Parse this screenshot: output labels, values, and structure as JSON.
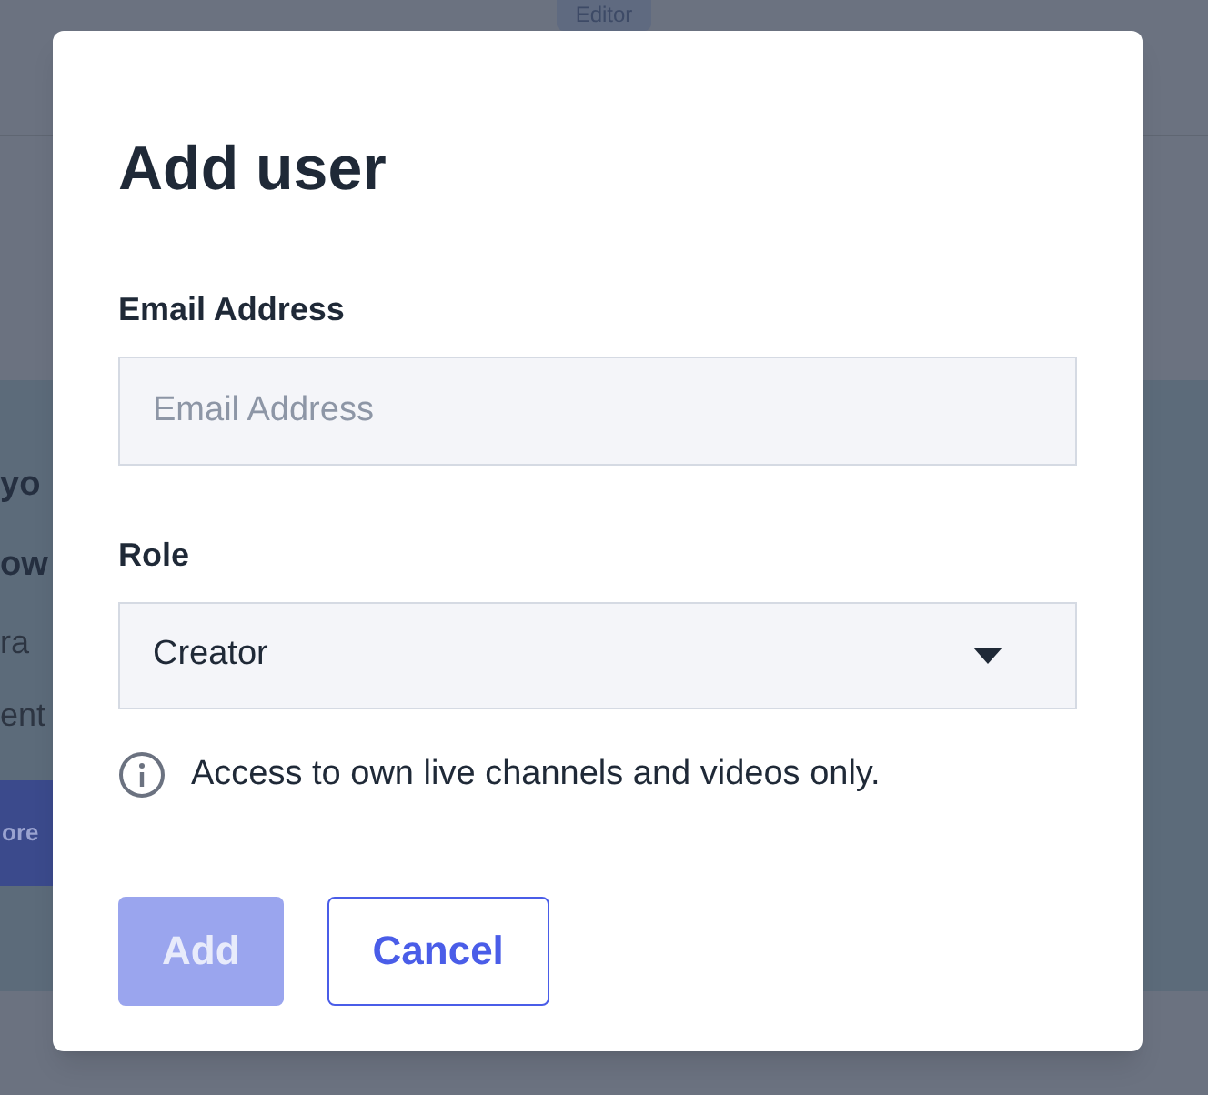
{
  "background": {
    "badge": "Editor",
    "fragments": [
      {
        "kind": "heading",
        "text": "yo"
      },
      {
        "kind": "heading",
        "text": "ow"
      },
      {
        "kind": "body",
        "text": "ra"
      },
      {
        "kind": "body",
        "text": "ent"
      },
      {
        "kind": "button",
        "text": "ore"
      }
    ]
  },
  "dialog": {
    "title": "Add user",
    "fields": [
      {
        "kind": "text",
        "label": "Email Address",
        "placeholder": "Email Address"
      },
      {
        "kind": "select",
        "label": "Role",
        "value": "Creator"
      }
    ],
    "hint": "Access to own live channels and videos only.",
    "buttons": [
      {
        "kind": "primary",
        "label": "Add",
        "disabled": true
      },
      {
        "kind": "secondary",
        "label": "Cancel",
        "disabled": false
      }
    ]
  }
}
